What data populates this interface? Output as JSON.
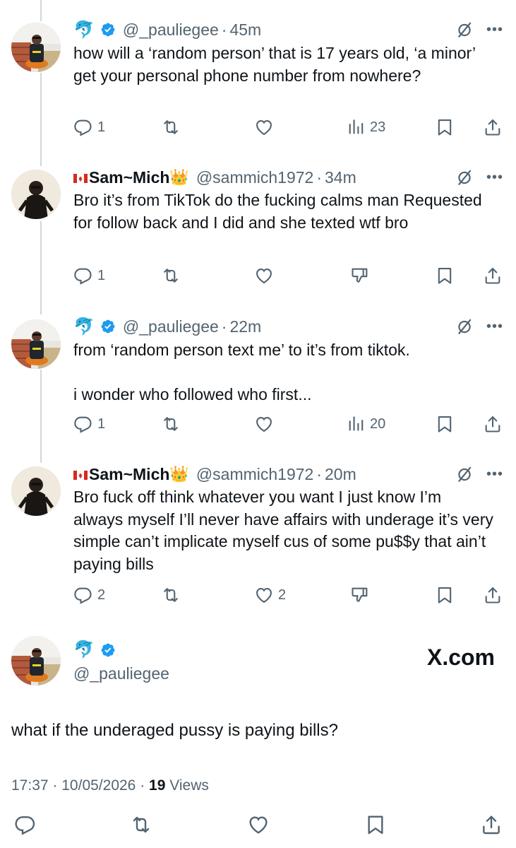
{
  "thread": [
    {
      "handle": "@_pauliegee",
      "time": "45m",
      "text": "how will a ‘random person’ that is 17 years old, ‘a minor’ get your personal phone number from nowhere?",
      "replies": "1",
      "likes": "",
      "views": "23"
    },
    {
      "display_name": "Sam~Mich",
      "handle": "@sammich1972",
      "time": "34m",
      "text": "Bro it’s from TikTok do the fucking calms man Requested for follow back and I did and she texted wtf bro",
      "replies": "1",
      "likes": ""
    },
    {
      "handle": "@_pauliegee",
      "time": "22m",
      "text": "from ‘random person text me’ to it’s from tiktok.\n\ni wonder who followed who first...",
      "replies": "1",
      "likes": "",
      "views": "20"
    },
    {
      "display_name": "Sam~Mich",
      "handle": "@sammich1972",
      "time": "20m",
      "text": "Bro fuck off think whatever you want I just know I’m always myself I’ll never have affairs with underage it’s very simple can’t implicate myself cus of some pu$$y that ain’t paying bills",
      "replies": "2",
      "likes": "2"
    }
  ],
  "focused": {
    "handle": "@_pauliegee",
    "text": "what if the underaged pussy is paying bills?",
    "time": "17:37",
    "date": "10/05/2026",
    "views_count": "19",
    "views_label": "Views",
    "sep": "·"
  },
  "watermark": "X.com",
  "ui": {
    "sep": "·",
    "more": "•••",
    "dolphin": "🐬",
    "crown": "👑"
  },
  "colors": {
    "text": "#0f1419",
    "secondary": "#536471",
    "verified": "#1d9bf0",
    "thread_line": "#cfd9de"
  },
  "icons": [
    "dolphin-emoji",
    "verified-badge-icon",
    "grok-icon",
    "more-icon",
    "reply-icon",
    "retweet-icon",
    "like-icon",
    "views-icon",
    "downvote-icon",
    "bookmark-icon",
    "share-icon",
    "canada-flag-icon",
    "crown-emoji"
  ]
}
